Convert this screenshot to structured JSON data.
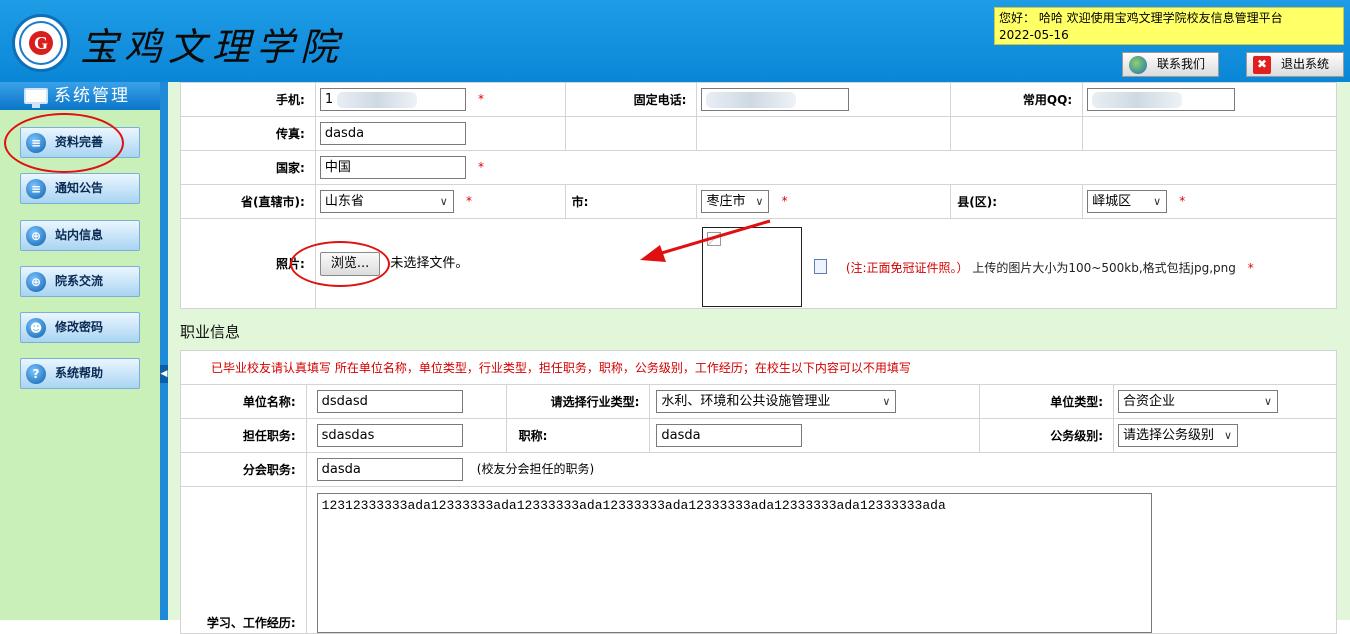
{
  "header": {
    "school_name": "宝鸡文理学院",
    "logo_char": "G",
    "welcome_line1": "您好： 哈哈 欢迎使用宝鸡文理学院校友信息管理平台",
    "welcome_line2": "2022-05-16",
    "contact_label": "联系我们",
    "logout_label": "退出系统",
    "logout_glyph": "✖"
  },
  "sidebar": {
    "title": "系统管理",
    "items": [
      {
        "label": "资料完善",
        "icon": "document-icon"
      },
      {
        "label": "通知公告",
        "icon": "notice-icon"
      },
      {
        "label": "站内信息",
        "icon": "globe-icon"
      },
      {
        "label": "院系交流",
        "icon": "globe-icon"
      },
      {
        "label": "修改密码",
        "icon": "users-icon"
      },
      {
        "label": "系统帮助",
        "icon": "help-icon"
      }
    ]
  },
  "contact": {
    "mobile_label": "手机:",
    "mobile_value": "1",
    "phone_label": "固定电话:",
    "qq_label": "常用QQ:",
    "fax_label": "传真:",
    "fax_value": "dasda",
    "country_label": "国家:",
    "country_value": "中国",
    "province_label": "省(直辖市):",
    "province_value": "山东省",
    "city_label": "市:",
    "city_value": "枣庄市",
    "county_label": "县(区):",
    "county_value": "峄城区",
    "required_mark": "*"
  },
  "photo": {
    "label": "照片:",
    "browse_label": "浏览...",
    "no_file_text": "未选择文件。",
    "note_paren": "(注:正面免冠证件照。）",
    "note_size": "上传的图片大小为100~500kb,格式包括jpg,png"
  },
  "career": {
    "section_title": "职业信息",
    "note": "已毕业校友请认真填写 所在单位名称，单位类型，行业类型，担任职务，职称，公务级别，工作经历；在校生以下内容可以不用填写",
    "unit_name_label": "单位名称:",
    "unit_name_value": "dsdasd",
    "industry_label": "请选择行业类型:",
    "industry_value": "水利、环境和公共设施管理业",
    "unit_type_label": "单位类型:",
    "unit_type_value": "合资企业",
    "position_label": "担任职务:",
    "position_value": "sdasdas",
    "title_label": "职称:",
    "title_value": "dasda",
    "civil_label": "公务级别:",
    "civil_value": "请选择公务级别",
    "branch_label": "分会职务:",
    "branch_value": "dasda",
    "branch_hint": "(校友分会担任的职务)",
    "experience_label": "学习、工作经历:",
    "experience_value": "12312333333ada12333333ada12333333ada12333333ada12333333ada12333333ada12333333ada"
  }
}
